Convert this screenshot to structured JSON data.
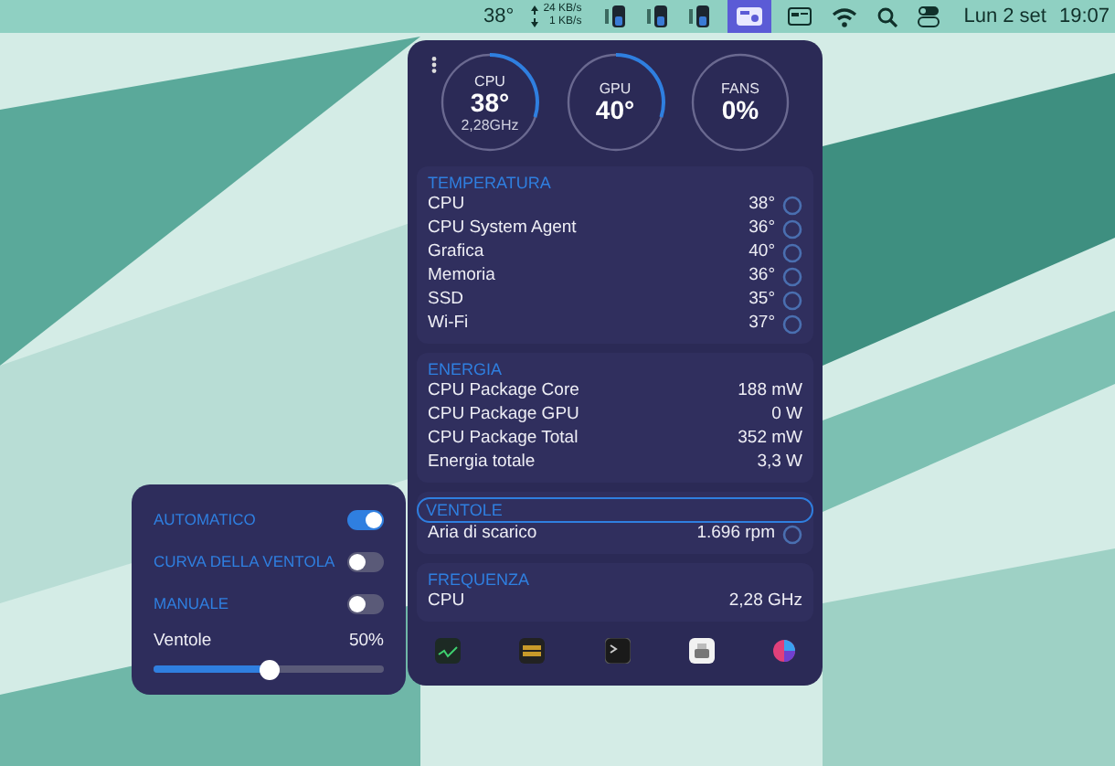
{
  "menu_bar": {
    "cpu_temp": "38°",
    "upload": "24 KB/s",
    "download": "1 KB/s",
    "icons": [
      {
        "kind": "battery",
        "selected": false
      },
      {
        "kind": "battery",
        "selected": false
      },
      {
        "kind": "battery",
        "selected": false
      },
      {
        "kind": "app",
        "selected": true
      },
      {
        "kind": "card",
        "selected": false
      },
      {
        "kind": "wifi",
        "selected": false
      },
      {
        "kind": "search",
        "selected": false
      },
      {
        "kind": "control",
        "selected": false
      }
    ],
    "date": "Lun 2 set",
    "time": "19:07"
  },
  "gauges": [
    {
      "label": "CPU",
      "value": "38°",
      "detail": "2,28GHz",
      "level": 0.3
    },
    {
      "label": "GPU",
      "value": "40°",
      "level": 0.3
    },
    {
      "label": "FANS",
      "value": "0%",
      "level": 0
    }
  ],
  "sections": [
    {
      "title": "TEMPERATURA",
      "focused": false,
      "rows": [
        {
          "label": "CPU",
          "value": "38°",
          "kind": "gauge"
        },
        {
          "label": "CPU System Agent",
          "value": "36°",
          "kind": "gauge"
        },
        {
          "label": "Grafica",
          "value": "40°",
          "kind": "gauge"
        },
        {
          "label": "Memoria",
          "value": "36°",
          "kind": "gauge"
        },
        {
          "label": "SSD",
          "value": "35°",
          "kind": "gauge"
        },
        {
          "label": "Wi-Fi",
          "value": "37°",
          "kind": "gauge"
        }
      ]
    },
    {
      "title": "ENERGIA",
      "focused": false,
      "rows": [
        {
          "label": "CPU Package Core",
          "value": "188 mW",
          "kind": "plain"
        },
        {
          "label": "CPU Package GPU",
          "value": "0 W",
          "kind": "plain"
        },
        {
          "label": "CPU Package Total",
          "value": "352 mW",
          "kind": "plain"
        },
        {
          "label": "Energia totale",
          "value": "3,3 W",
          "kind": "plain"
        }
      ]
    },
    {
      "title": "VENTOLE",
      "focused": true,
      "rows": [
        {
          "label": "Aria di scarico",
          "value": "1.696 rpm",
          "kind": "gauge"
        }
      ]
    },
    {
      "title": "FREQUENZA",
      "focused": false,
      "rows": [
        {
          "label": "CPU",
          "value": "2,28 GHz",
          "kind": "plain"
        }
      ]
    }
  ],
  "toolbar": [
    {
      "kind": "monitor"
    },
    {
      "kind": "chip"
    },
    {
      "kind": "terminal"
    },
    {
      "kind": "printer"
    },
    {
      "kind": "color"
    }
  ],
  "fan_popup": {
    "modes": [
      {
        "label": "AUTOMATICO",
        "on": true
      },
      {
        "label": "CURVA DELLA VENTOLA",
        "on": false
      },
      {
        "label": "MANUALE",
        "on": false
      }
    ],
    "slider": {
      "label": "Ventole",
      "value": "50%",
      "level": 0.5
    }
  }
}
